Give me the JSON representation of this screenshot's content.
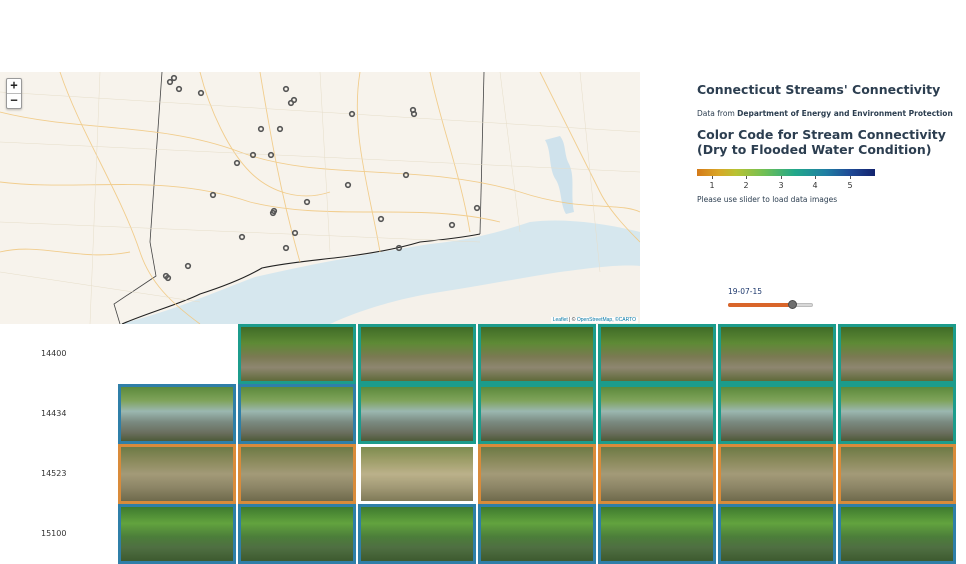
{
  "map": {
    "zoom_in": "+",
    "zoom_out": "−",
    "attribution": {
      "leaflet": "Leaflet",
      "separator": " | © ",
      "osm": "OpenStreetMap",
      "carto": ", ©CARTO"
    }
  },
  "panel": {
    "title": "Connecticut Streams' Connectivity",
    "source_prefix": "Data from ",
    "source_org": "Department of Energy and Environment Protection",
    "legend_title": "Color Code for Stream Connectivity (Dry to Flooded Water Condition)",
    "legend_ticks": [
      "1",
      "2",
      "3",
      "4",
      "5"
    ],
    "hint": "Please use slider to load data images"
  },
  "slider": {
    "value_label": "19-07-15",
    "fraction": 0.75
  },
  "colors": {
    "dry": "#d98b3a",
    "teal": "#1c9c8c",
    "blue": "#2f7fa8",
    "white": "#ffffff"
  },
  "sites": [
    {
      "id": "14400",
      "frames": [
        "",
        "teal",
        "teal",
        "teal",
        "teal",
        "teal",
        "teal"
      ],
      "scene": "forest"
    },
    {
      "id": "14434",
      "frames": [
        "blue",
        "blue",
        "teal",
        "teal",
        "teal",
        "teal",
        "teal"
      ],
      "scene": "creek"
    },
    {
      "id": "14523",
      "frames": [
        "dry",
        "dry",
        "white",
        "dry",
        "dry",
        "dry",
        "dry"
      ],
      "scene": "dry"
    },
    {
      "id": "15100",
      "frames": [
        "blue",
        "blue",
        "blue",
        "blue",
        "blue",
        "blue",
        "blue"
      ],
      "scene": "pool"
    }
  ]
}
